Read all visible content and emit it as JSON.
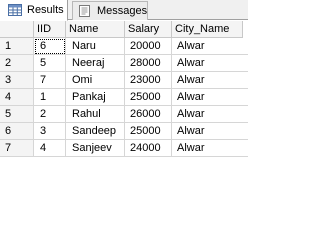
{
  "tabs": {
    "results_label": "Results",
    "messages_label": "Messages"
  },
  "grid": {
    "columns": [
      "IID",
      "Name",
      "Salary",
      "City_Name"
    ],
    "rows": [
      {
        "num": "1",
        "iid": "6",
        "name": "Naru",
        "salary": "20000",
        "city": "Alwar"
      },
      {
        "num": "2",
        "iid": "5",
        "name": "Neeraj",
        "salary": "28000",
        "city": "Alwar"
      },
      {
        "num": "3",
        "iid": "7",
        "name": "Omi",
        "salary": "23000",
        "city": "Alwar"
      },
      {
        "num": "4",
        "iid": "1",
        "name": "Pankaj",
        "salary": "25000",
        "city": "Alwar"
      },
      {
        "num": "5",
        "iid": "2",
        "name": "Rahul",
        "salary": "26000",
        "city": "Alwar"
      },
      {
        "num": "6",
        "iid": "3",
        "name": "Sandeep",
        "salary": "25000",
        "city": "Alwar"
      },
      {
        "num": "7",
        "iid": "4",
        "name": "Sanjeev",
        "salary": "24000",
        "city": "Alwar"
      }
    ]
  }
}
